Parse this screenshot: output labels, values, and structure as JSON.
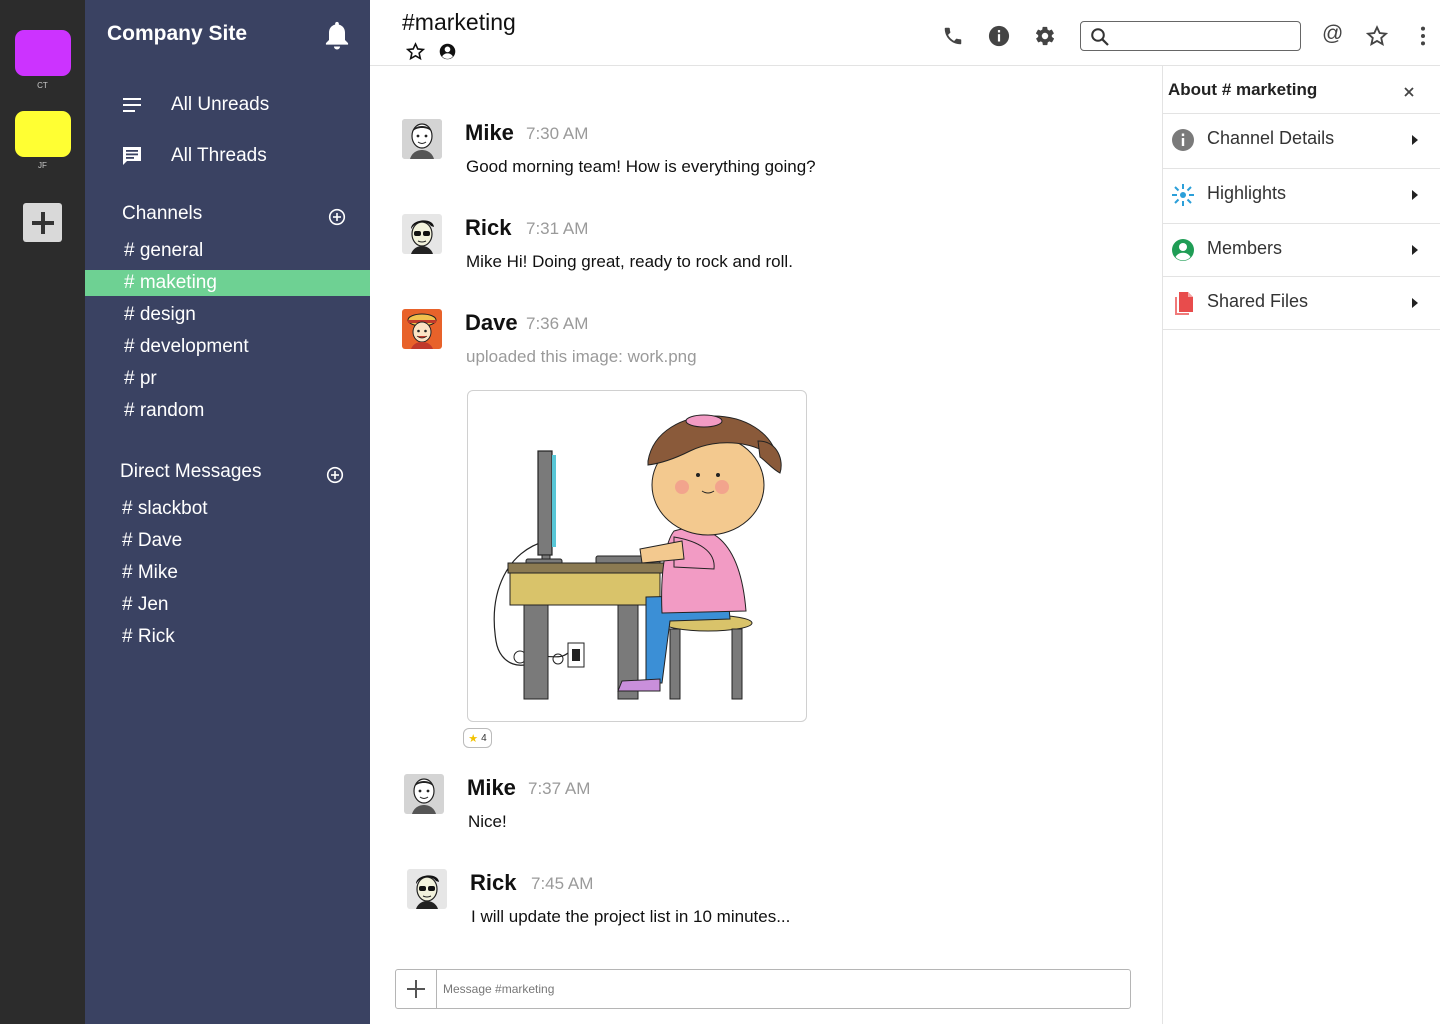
{
  "workspaces": [
    {
      "label": "CT",
      "color": "#cc33ff"
    },
    {
      "label": "JF",
      "color": "#ffff33"
    }
  ],
  "sidebar": {
    "team_name": "Company Site",
    "nav": [
      {
        "label": "All Unreads",
        "icon": "list-icon"
      },
      {
        "label": "All Threads",
        "icon": "threads-icon"
      }
    ],
    "channels_title": "Channels",
    "channels": [
      "# general",
      "# maketing",
      "# design",
      "# development",
      "# pr",
      "# random"
    ],
    "active_channel": "# maketing",
    "dm_title": "Direct Messages",
    "dms": [
      "# slackbot",
      "# Dave",
      "# Mike",
      "# Jen",
      "# Rick"
    ]
  },
  "header": {
    "channel_title": "#marketing",
    "search_placeholder": "",
    "mention_label": "@"
  },
  "messages": [
    {
      "author": "Mike",
      "time": "7:30 AM",
      "text": "Good morning team! How is everything going?"
    },
    {
      "author": "Rick",
      "time": "7:31 AM",
      "text": "Mike Hi! Doing great, ready to rock and roll."
    },
    {
      "author": "Dave",
      "time": "7:36 AM",
      "text": "uploaded this image: work.png"
    },
    {
      "author": "Mike",
      "time": "7:37 AM",
      "text": "Nice!"
    },
    {
      "author": "Rick",
      "time": "7:45 AM",
      "text": "I will update the project list in 10 minutes..."
    }
  ],
  "reaction": {
    "emoji": "★",
    "count": "4"
  },
  "composer": {
    "placeholder": "Message #marketing"
  },
  "right_panel": {
    "title": "About # marketing",
    "items": [
      {
        "label": "Channel Details",
        "icon": "info-icon"
      },
      {
        "label": "Highlights",
        "icon": "highlights-icon"
      },
      {
        "label": "Members",
        "icon": "members-icon"
      },
      {
        "label": "Shared Files",
        "icon": "files-icon"
      }
    ]
  },
  "colors": {
    "rail": "#2c2c2c",
    "sidebar": "#3a4262",
    "active_channel": "#6ed193",
    "highlights_icon": "#2b9fd9",
    "members_icon": "#1f9d55",
    "files_icon": "#e84c4c"
  }
}
